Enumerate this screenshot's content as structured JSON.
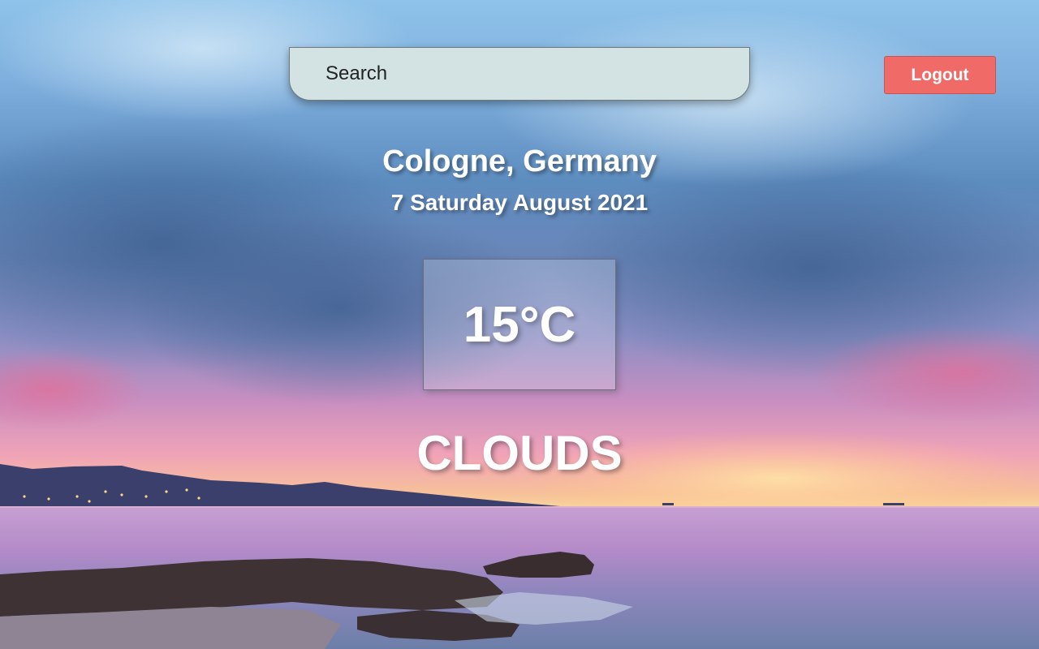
{
  "search": {
    "placeholder": "Search",
    "value": ""
  },
  "header": {
    "logout_label": "Logout"
  },
  "weather": {
    "location": "Cologne, Germany",
    "date": "7 Saturday August 2021",
    "temperature": "15°C",
    "condition": "CLOUDS"
  },
  "colors": {
    "logout_bg": "#f06b68",
    "search_bg": "#d3e3e4",
    "text": "#ffffff"
  },
  "background": {
    "scene": "sunset-sea-beach-photo"
  }
}
